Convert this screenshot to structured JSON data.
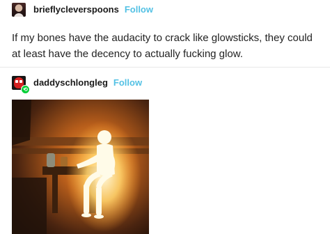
{
  "post1": {
    "username": "brieflycleverspoons",
    "follow_label": "Follow",
    "text": "If my bones have the audacity to crack like glowsticks, they could at least have the decency to actually fucking glow."
  },
  "post2": {
    "username": "daddyschlongleg",
    "follow_label": "Follow"
  },
  "icons": {
    "avatar_post2": "spider-mask-avatar",
    "reblog_badge": "reblog-icon"
  },
  "colors": {
    "follow": "#53c1e4",
    "reblog_badge": "#00cf35"
  }
}
